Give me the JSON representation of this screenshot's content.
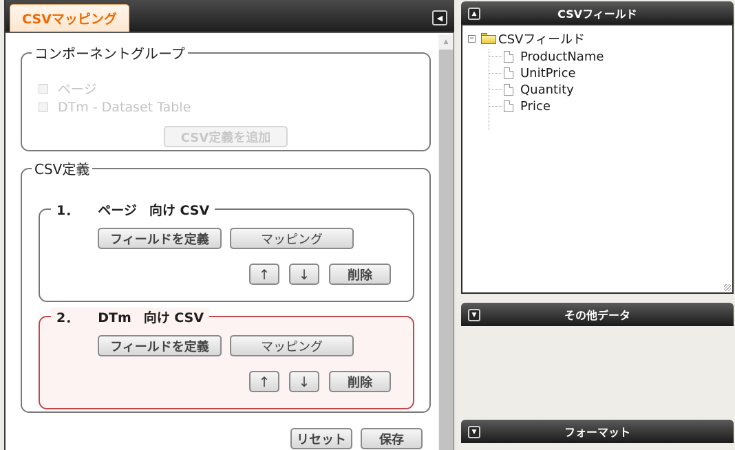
{
  "left_panel": {
    "tab_label": "CSVマッピング",
    "collapse_icon": "collapse-left-icon",
    "component_group": {
      "legend": "コンポーネントグループ",
      "items": [
        {
          "label": "ページ",
          "checked": false,
          "enabled": false
        },
        {
          "label": "DTm - Dataset Table",
          "checked": false,
          "enabled": false
        }
      ],
      "add_button_label": "CSV定義を追加"
    },
    "csv_definitions": {
      "legend": "CSV定義",
      "cards": [
        {
          "number": "1．",
          "title": "ページ",
          "suffix": "向け CSV",
          "define_label": "フィールドを定義",
          "mapping_label": "マッピング",
          "up_label": "↑",
          "down_label": "↓",
          "delete_label": "削除",
          "selected": false
        },
        {
          "number": "2．",
          "title": "DTm",
          "suffix": "向け CSV",
          "define_label": "フィールドを定義",
          "mapping_label": "マッピング",
          "up_label": "↑",
          "down_label": "↓",
          "delete_label": "削除",
          "selected": true
        }
      ]
    },
    "reset_label": "リセット",
    "save_label": "保存"
  },
  "right_panel": {
    "csv_field_panel": {
      "title": "CSVフィールド",
      "root_label": "CSVフィールド",
      "fields": [
        "ProductName",
        "UnitPrice",
        "Quantity",
        "Price"
      ]
    },
    "other_data_title": "その他データ",
    "format_title": "フォーマット"
  },
  "colors": {
    "tab_text": "#ee6a00",
    "selected_card_border": "#c04848",
    "selected_card_bg": "#fdf3f3"
  }
}
